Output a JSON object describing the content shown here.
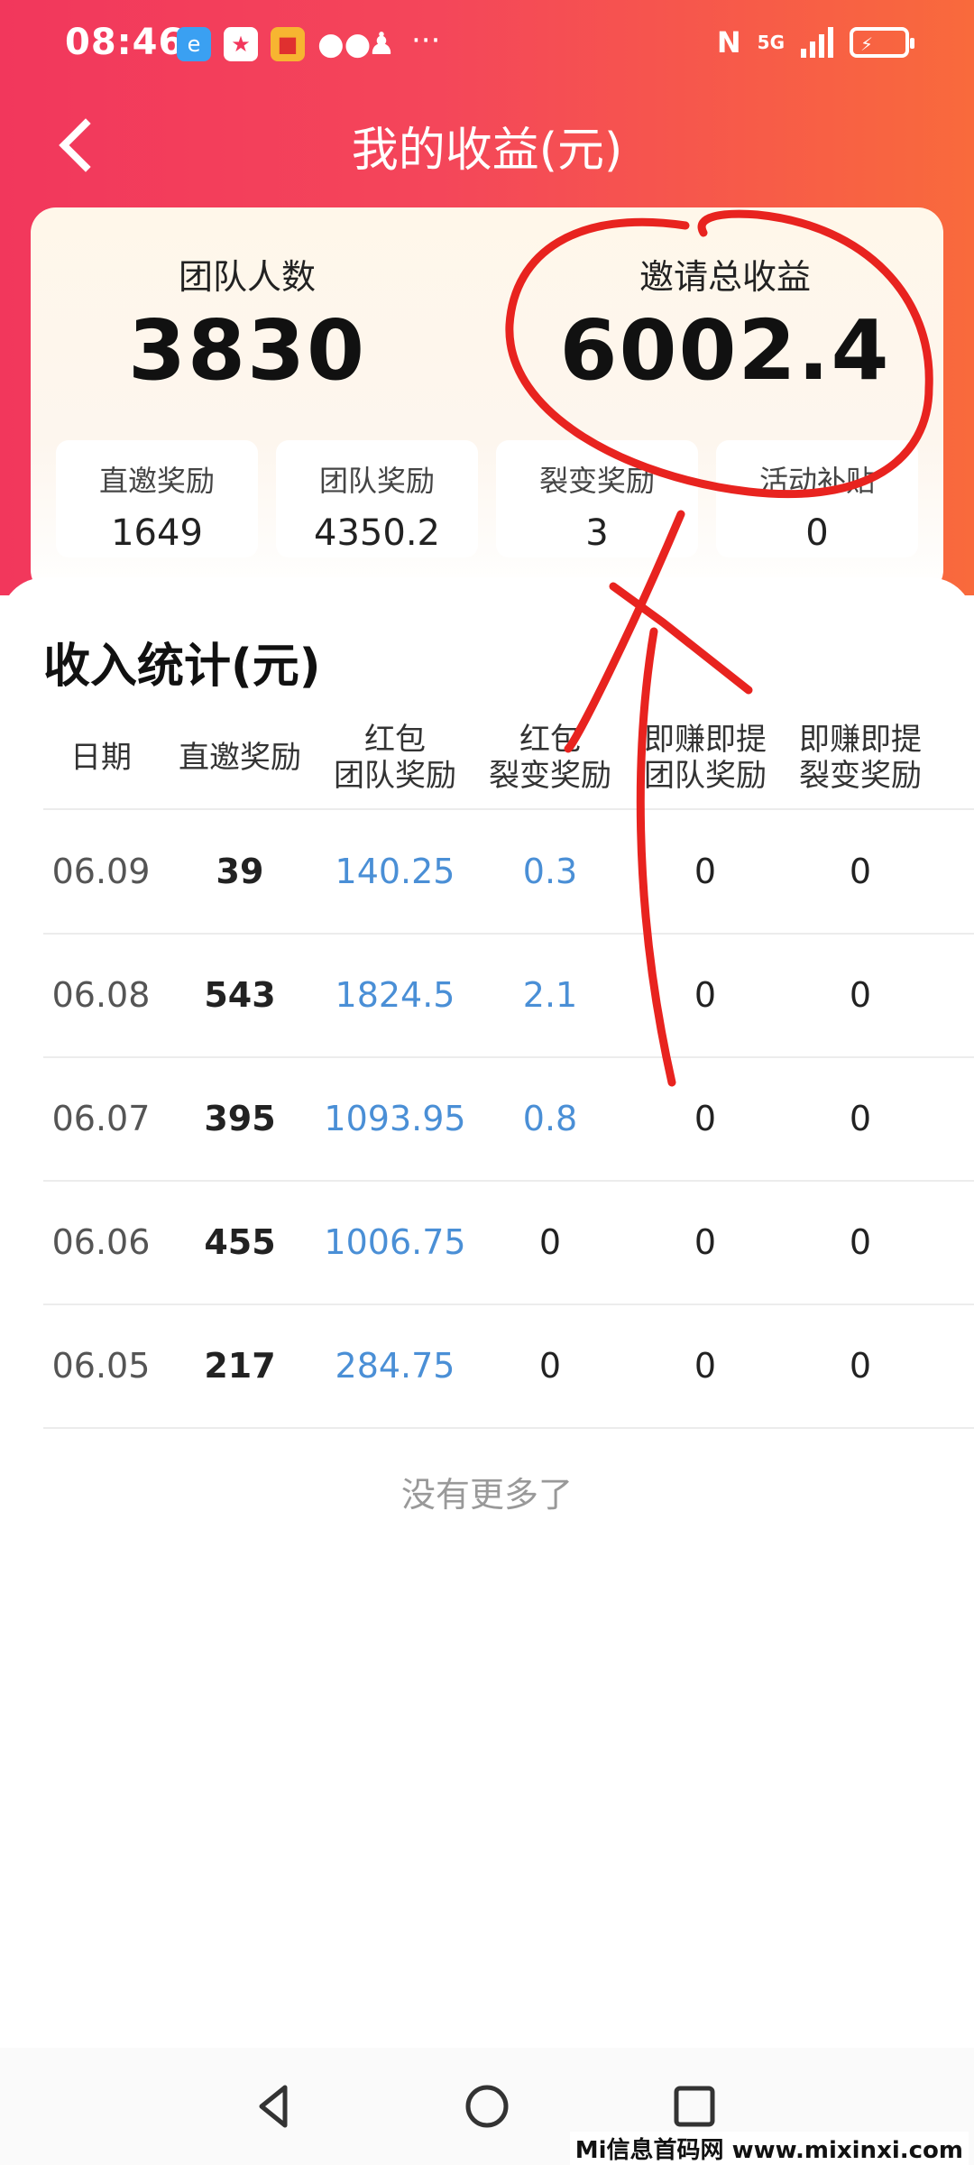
{
  "status_bar": {
    "time": "08:46",
    "network": "5G",
    "icons": [
      "browser-icon",
      "game-icon",
      "red-packet-icon",
      "wechat-icon",
      "qq-icon"
    ],
    "more": "···"
  },
  "nav": {
    "title": "我的收益(元)"
  },
  "summary": {
    "team_label": "团队人数",
    "team_value": "3830",
    "invite_label": "邀请总收益",
    "invite_value": "6002.4",
    "items": [
      {
        "label": "直邀奖励",
        "value": "1649"
      },
      {
        "label": "团队奖励",
        "value": "4350.2"
      },
      {
        "label": "裂变奖励",
        "value": "3"
      },
      {
        "label": "活动补贴",
        "value": "0"
      }
    ]
  },
  "stats": {
    "title": "收入统计(元)",
    "headers": [
      {
        "line1": "日期",
        "line2": ""
      },
      {
        "line1": "直邀奖励",
        "line2": ""
      },
      {
        "line1": "红包",
        "line2": "团队奖励"
      },
      {
        "line1": "红包",
        "line2": "裂变奖励"
      },
      {
        "line1": "即赚即提",
        "line2": "团队奖励"
      },
      {
        "line1": "即赚即提",
        "line2": "裂变奖励"
      }
    ],
    "rows": [
      [
        "06.09",
        "39",
        "140.25",
        "0.3",
        "0",
        "0"
      ],
      [
        "06.08",
        "543",
        "1824.5",
        "2.1",
        "0",
        "0"
      ],
      [
        "06.07",
        "395",
        "1093.95",
        "0.8",
        "0",
        "0"
      ],
      [
        "06.06",
        "455",
        "1006.75",
        "0",
        "0",
        "0"
      ],
      [
        "06.05",
        "217",
        "284.75",
        "0",
        "0",
        "0"
      ]
    ],
    "no_more": "没有更多了"
  },
  "watermark": "Mi信息首码网 www.mixinxi.com",
  "colors": {
    "header_start": "#f2375c",
    "header_end": "#f96a3c",
    "link_blue": "#4a8fd6",
    "annotation_red": "#e8231f"
  }
}
